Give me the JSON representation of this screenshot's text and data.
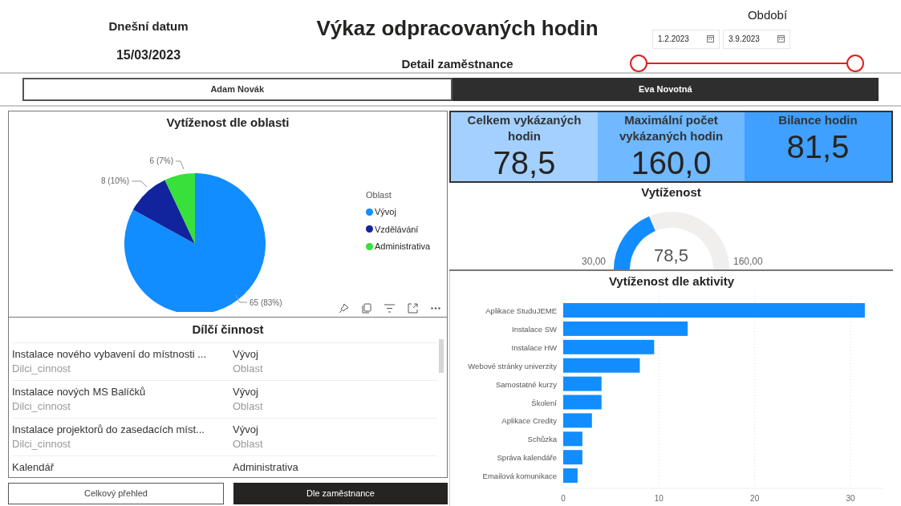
{
  "header": {
    "date_label": "Dnešní datum",
    "date_value": "15/03/2023",
    "title": "Výkaz odpracovaných hodin",
    "subtitle": "Detail zaměstnance",
    "period_label": "Období",
    "date_from": "1.2.2023",
    "date_to": "3.9.2023",
    "slider_thumbs": [
      {
        "level": 0
      },
      {
        "level": 1
      }
    ]
  },
  "employees": [
    {
      "label": "Adam Novák",
      "selected": false
    },
    {
      "label": "Eva Novotná",
      "selected": true
    }
  ],
  "pie_panel": {
    "title": "Vytíženost dle oblasti",
    "legend_title": "Oblast",
    "chart_data": {
      "type": "pie",
      "categories": [
        "Vývoj",
        "Vzdělávání",
        "Administrativa"
      ],
      "series": [
        {
          "values": [
            83,
            10,
            7
          ]
        }
      ],
      "colors": [
        "#118dff",
        "#12239e",
        "#37e03a"
      ],
      "value_labels": [
        "65 (83%)",
        "8 (10%)",
        "6 (7%)"
      ]
    }
  },
  "table": {
    "title": "Dílčí činnost",
    "rows": [
      {
        "activity": "Instalace nového vybavení do místnosti ...",
        "area": "Vývoj",
        "activity_label": "Dilci_cinnost",
        "area_label": "Oblast"
      },
      {
        "activity": "Instalace nových MS Balíčků",
        "area": "Vývoj",
        "activity_label": "Dilci_cinnost",
        "area_label": "Oblast"
      },
      {
        "activity": "Instalace projektorů do zasedacích míst...",
        "area": "Vývoj",
        "activity_label": "Dilci_cinnost",
        "area_label": "Oblast"
      },
      {
        "activity": "Kalendář",
        "area": "Administrativa"
      }
    ]
  },
  "pages": [
    {
      "label": "Celkový přehled",
      "selected": false
    },
    {
      "label": "Dle zaměstnance",
      "selected": true
    }
  ],
  "kpis": [
    {
      "label": "Celkem vykázaných hodin",
      "value": "78,5",
      "color": "#a3d0ff"
    },
    {
      "label": "Maximální počet vykázaných hodin",
      "value": "160,0",
      "color": "#70b8ff"
    },
    {
      "label": "Bilance hodin",
      "value": "81,5",
      "color": "#3fa0ff"
    }
  ],
  "gauge": {
    "title": "Vytíženost",
    "value": "78,5",
    "min": "30,00",
    "max": "160,00"
  },
  "bar_panel": {
    "title": "Vytíženost dle aktivity",
    "chart_data": {
      "type": "bar",
      "orientation": "horizontal",
      "categories": [
        "Aplikace StuduJEME",
        "Instalace SW",
        "Instalace HW",
        "Webové stránky univerzity",
        "Samostatné kurzy",
        "Školení",
        "Aplikace Credity",
        "Schůzka",
        "Správa kalendáře",
        "Emailová komunikace"
      ],
      "series": [
        {
          "color": "#118dff",
          "values": [
            31.5,
            13,
            9.5,
            8,
            4,
            4,
            3,
            2,
            2,
            1.5
          ]
        }
      ],
      "xlim": [
        0,
        33.5
      ],
      "xticks": [
        0,
        10,
        20,
        30
      ],
      "grid": true
    }
  }
}
